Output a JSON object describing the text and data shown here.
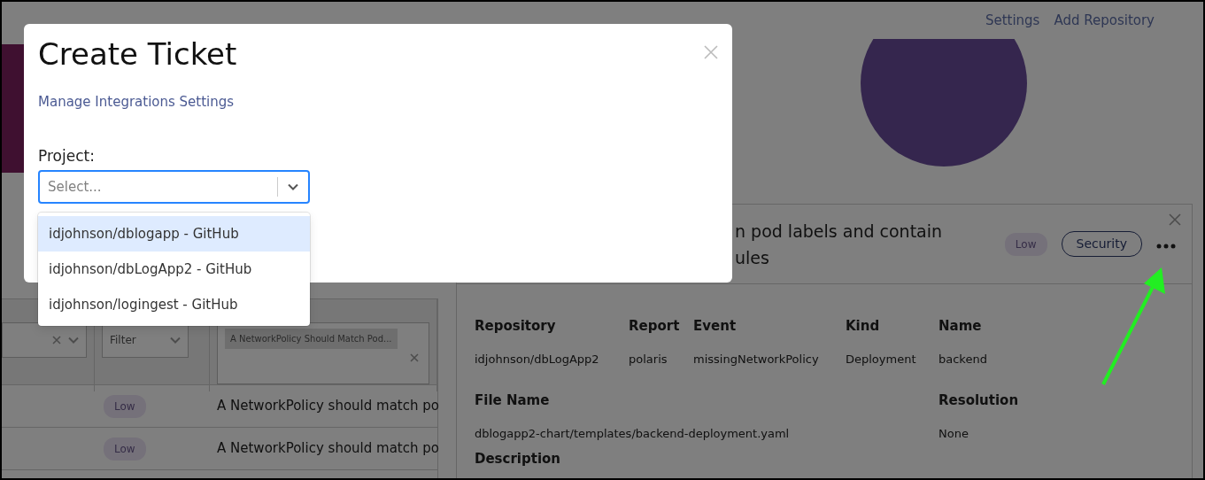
{
  "nav": {
    "links": [
      "Settings",
      "Add Repository"
    ]
  },
  "findings_table": {
    "filters": [
      {
        "kind": "clear-select"
      },
      {
        "kind": "select",
        "placeholder": "Filter"
      },
      {
        "kind": "tag-select",
        "tags": [
          "A NetworkPolicy Should Match Pod..."
        ]
      }
    ],
    "rows": [
      {
        "severity": "Low",
        "title": "A NetworkPolicy should match po"
      },
      {
        "severity": "Low",
        "title": "A NetworkPolicy should match po"
      }
    ]
  },
  "detail_panel": {
    "title_lines": [
      "n pod labels and contain",
      "ules"
    ],
    "severity": "Low",
    "category": "Security",
    "field_rows": [
      [
        {
          "label": "Repository",
          "value": "idjohnson/dbLogApp2"
        },
        {
          "label": "Report",
          "value": "polaris"
        },
        {
          "label": "Event",
          "value": "missingNetworkPolicy"
        },
        {
          "label": "Kind",
          "value": "Deployment"
        },
        {
          "label": "Name",
          "value": "backend"
        }
      ],
      [
        {
          "label": "File Name",
          "value": "dblogapp2-chart/templates/backend-deployment.yaml"
        },
        {
          "label": "Resolution",
          "value": "None"
        }
      ]
    ],
    "section_heading": "Description"
  },
  "modal": {
    "title": "Create Ticket",
    "link": "Manage Integrations Settings",
    "project_label": "Project:",
    "select": {
      "placeholder": "Select...",
      "expanded": true
    },
    "options": [
      {
        "label": "idjohnson/dblogapp - GitHub",
        "selected": true
      },
      {
        "label": "idjohnson/dbLogApp2 - GitHub",
        "selected": false
      },
      {
        "label": "idjohnson/logingest - GitHub",
        "selected": false
      }
    ]
  }
}
